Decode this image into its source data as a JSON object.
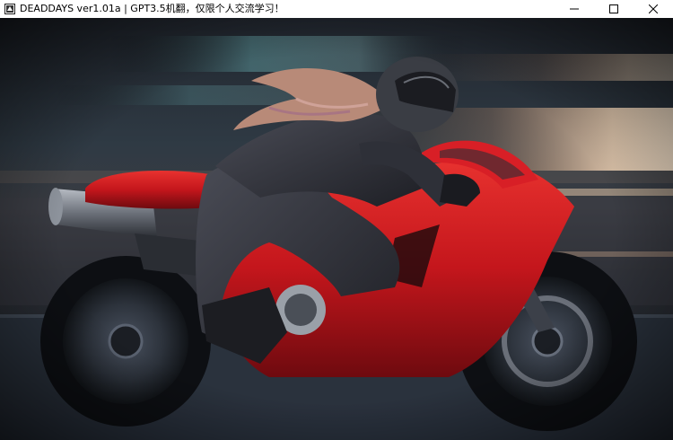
{
  "window": {
    "title": "DEADDAYS ver1.01a | GPT3.5机翻，仅限个人交流学习！",
    "icon": "game-app-icon"
  },
  "controls": {
    "minimize_icon": "minimize-icon",
    "maximize_icon": "maximize-icon",
    "close_icon": "close-icon"
  },
  "scene": {
    "description_icon": "motorcycle-rider-illustration",
    "colors": {
      "bike_red": "#c4161c",
      "suit_dark": "#2b2c33",
      "helmet": "#3a3d44",
      "hair": "#b88a78",
      "background_top": "#2a3038",
      "road": "#2c3440"
    }
  }
}
